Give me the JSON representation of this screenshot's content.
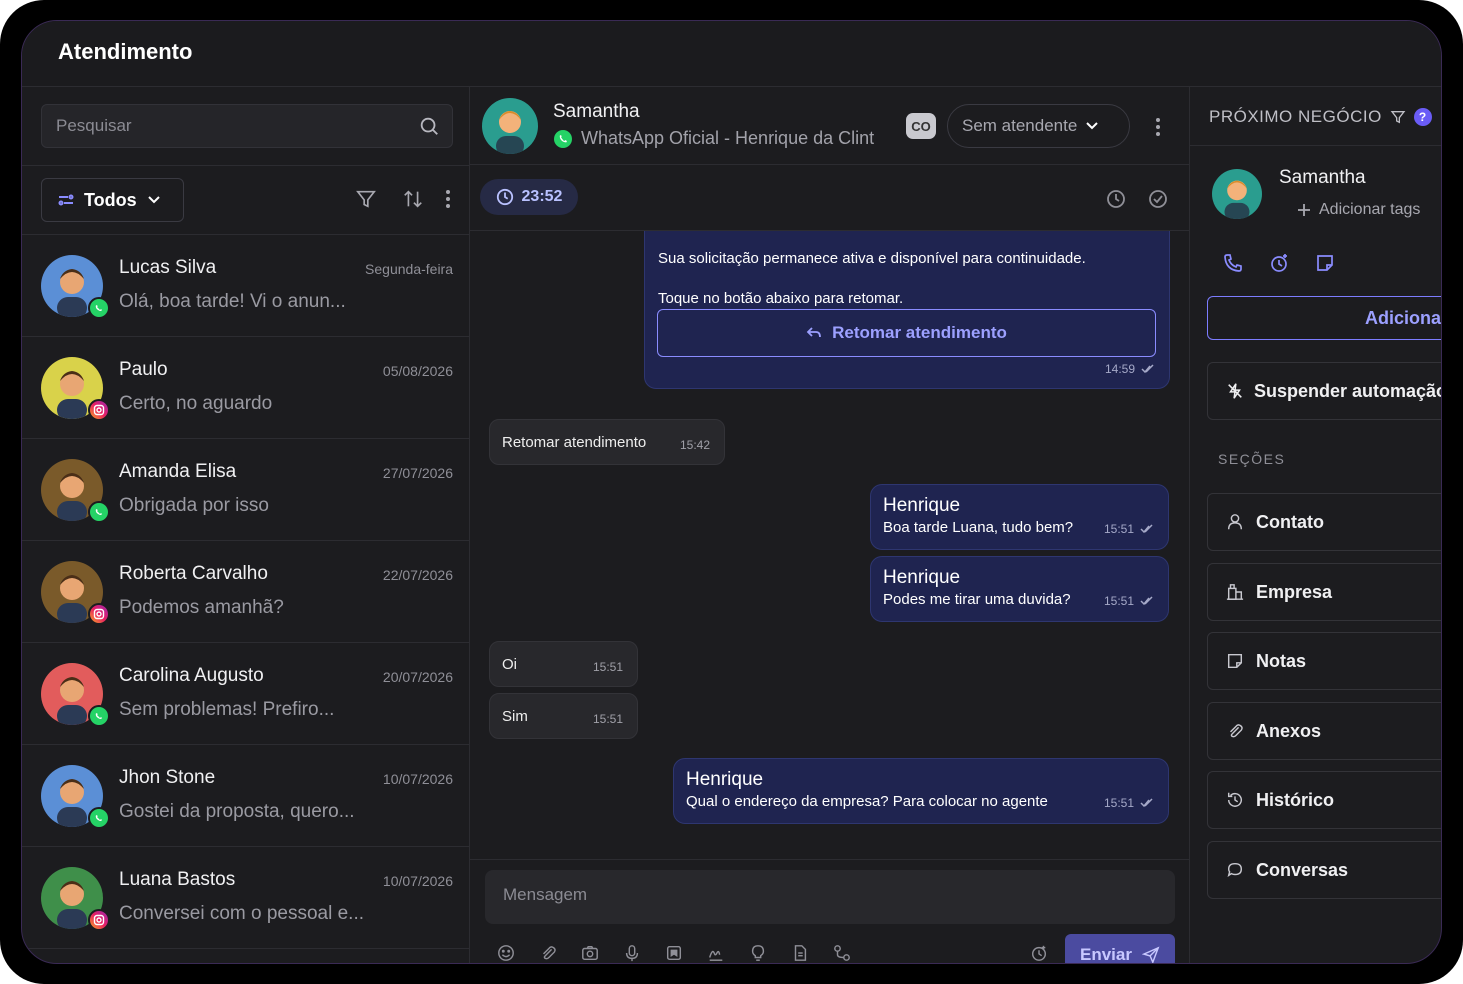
{
  "app": {
    "title": "Atendimento"
  },
  "left": {
    "search_placeholder": "Pesquisar",
    "filter_label": "Todos",
    "conversations": [
      {
        "name": "Lucas Silva",
        "date": "Segunda-feira",
        "message": "Olá, boa tarde! Vi o anun...",
        "channel": "whatsapp",
        "avatar_color": "#5b8fd6"
      },
      {
        "name": "Paulo",
        "date": "05/08/2026",
        "message": "Certo, no aguardo",
        "channel": "instagram",
        "avatar_color": "#d9d24a"
      },
      {
        "name": "Amanda Elisa",
        "date": "27/07/2026",
        "message": "Obrigada por isso",
        "channel": "whatsapp",
        "avatar_color": "#7a5a2a"
      },
      {
        "name": "Roberta Carvalho",
        "date": "22/07/2026",
        "message": "Podemos amanhã?",
        "channel": "instagram",
        "avatar_color": "#7a5a2a"
      },
      {
        "name": "Carolina Augusto",
        "date": "20/07/2026",
        "message": "Sem problemas! Prefiro...",
        "channel": "whatsapp",
        "avatar_color": "#e25c5c"
      },
      {
        "name": "Jhon Stone",
        "date": "10/07/2026",
        "message": "Gostei da proposta, quero...",
        "channel": "whatsapp",
        "avatar_color": "#5b8fd6"
      },
      {
        "name": "Luana Bastos",
        "date": "10/07/2026",
        "message": "Conversei com o pessoal e...",
        "channel": "instagram",
        "avatar_color": "#3f8f4a"
      }
    ]
  },
  "chat": {
    "contact_name": "Samantha",
    "channel_label": "WhatsApp Oficial - Henrique da Clint",
    "co_badge": "CO",
    "attendant_select": "Sem atendente",
    "timer": "23:52",
    "system_message": {
      "line1": "Sua solicitação permanece ativa e disponível para continuidade.",
      "line2": "Toque no botão abaixo para retomar.",
      "button": "Retomar atendimento",
      "time": "14:59"
    },
    "messages": [
      {
        "dir": "in",
        "text": "Retomar atendimento",
        "time": "15:42"
      },
      {
        "dir": "out",
        "author": "Henrique",
        "text": "Boa tarde Luana, tudo bem?",
        "time": "15:51"
      },
      {
        "dir": "out",
        "author": "Henrique",
        "text": "Podes me tirar uma duvida?",
        "time": "15:51"
      },
      {
        "dir": "in",
        "text": "Oi",
        "time": "15:51"
      },
      {
        "dir": "in",
        "text": "Sim",
        "time": "15:51"
      },
      {
        "dir": "out",
        "author": "Henrique",
        "text": "Qual o endereço da empresa? Para colocar no agente",
        "time": "15:51"
      }
    ],
    "composer_placeholder": "Mensagem",
    "send_label": "Enviar"
  },
  "right": {
    "header": "PRÓXIMO NEGÓCIO",
    "help": "?",
    "contact_name": "Samantha",
    "add_tags": "Adicionar tags",
    "add_button": "Adicionar",
    "suspend_button": "Suspender automação",
    "sections_label": "SEÇÕES",
    "sections": [
      "Contato",
      "Empresa",
      "Notas",
      "Anexos",
      "Histórico",
      "Conversas"
    ]
  },
  "colors": {
    "accent": "#7c7cff",
    "bubble_out": "#1f2450",
    "whatsapp": "#25d366"
  }
}
